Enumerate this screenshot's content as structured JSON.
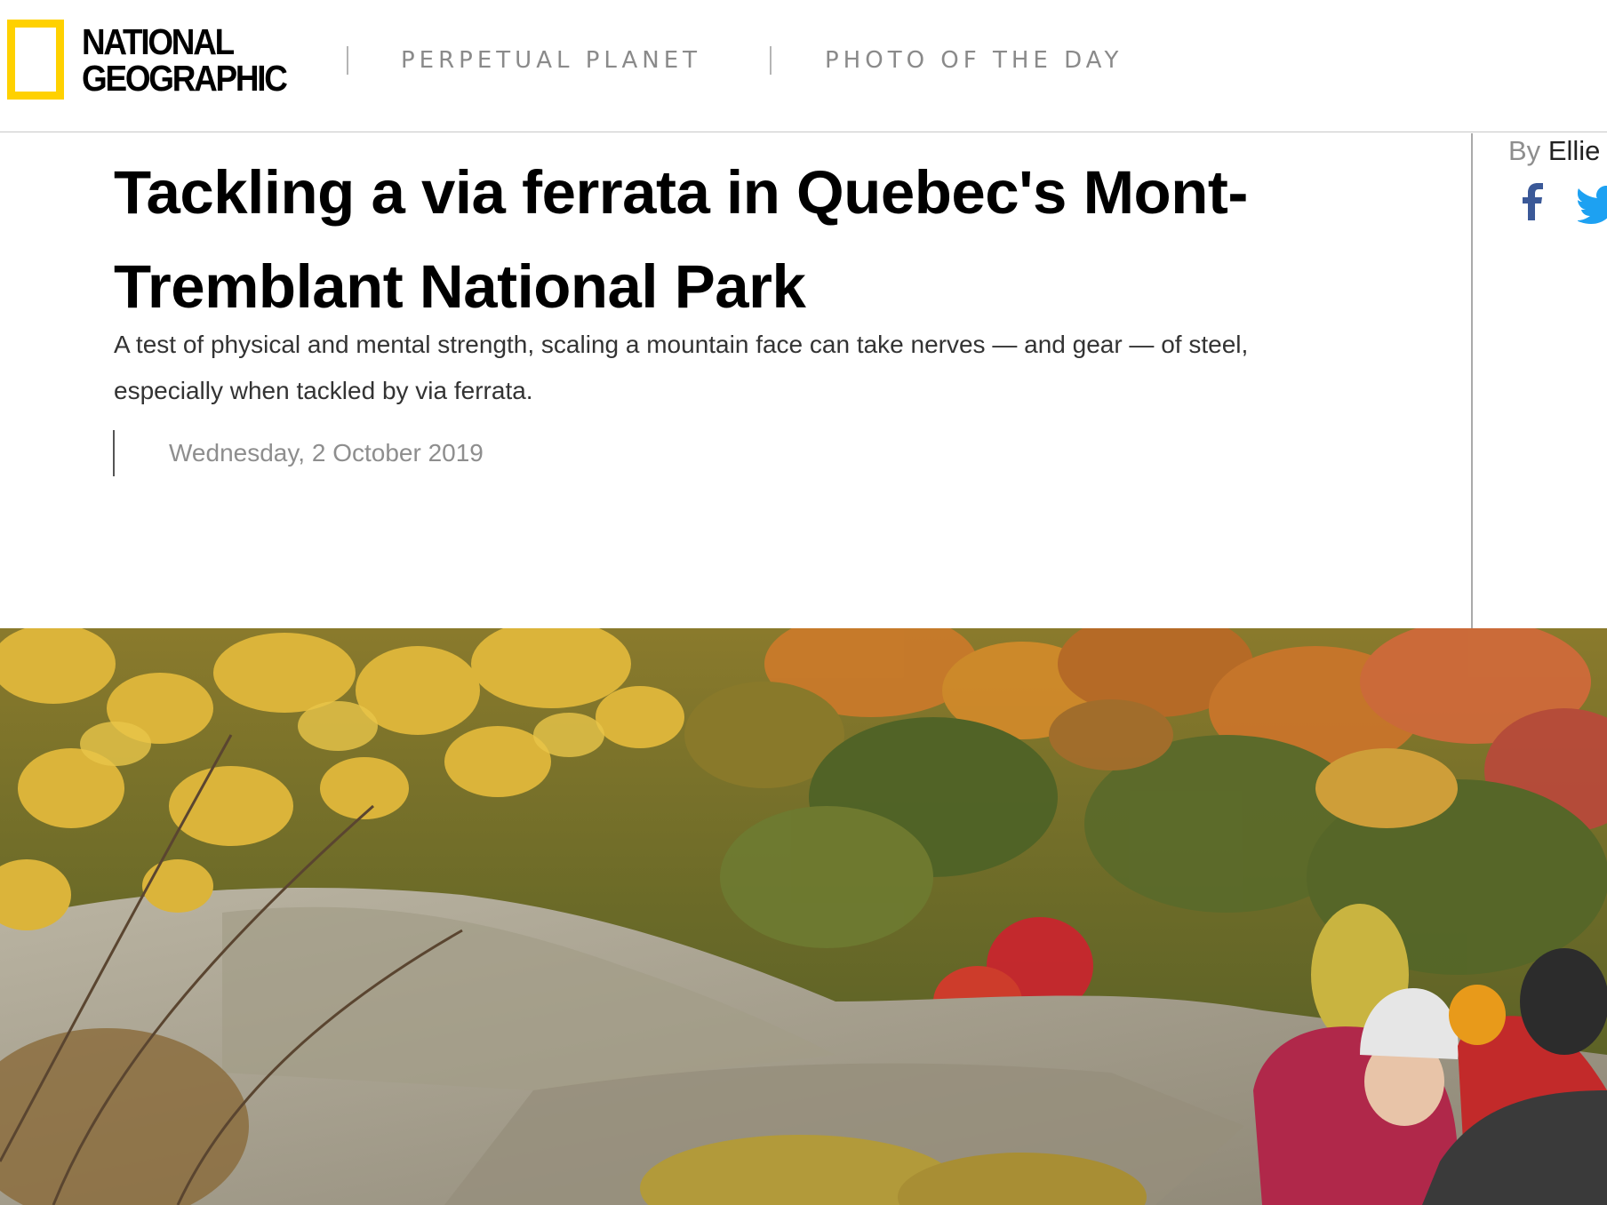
{
  "header": {
    "logo": {
      "line1": "NATIONAL",
      "line2": "GEOGRAPHIC",
      "frame_color": "#FFD100"
    },
    "nav": [
      {
        "label": "PERPETUAL PLANET"
      },
      {
        "label": "PHOTO OF THE DAY"
      }
    ]
  },
  "article": {
    "headline": "Tackling a via ferrata in Quebec's Mont-Tremblant National Park",
    "dek": "A test of physical and mental strength, scaling a mountain face can take nerves — and gear — of steel, especially when tackled by via ferrata.",
    "date": "Wednesday, 2 October 2019"
  },
  "sidebar": {
    "by_label": "By",
    "author": "Ellie",
    "share": [
      {
        "icon": "facebook-icon",
        "color": "#3b5998"
      },
      {
        "icon": "twitter-icon",
        "color": "#1da1f2"
      }
    ]
  },
  "hero_image": {
    "subject": "climbers on a via ferrata rock face with autumn forest",
    "palette": [
      "#d9a93a",
      "#c4621f",
      "#5b6b2a",
      "#a49c88",
      "#c02030"
    ]
  }
}
